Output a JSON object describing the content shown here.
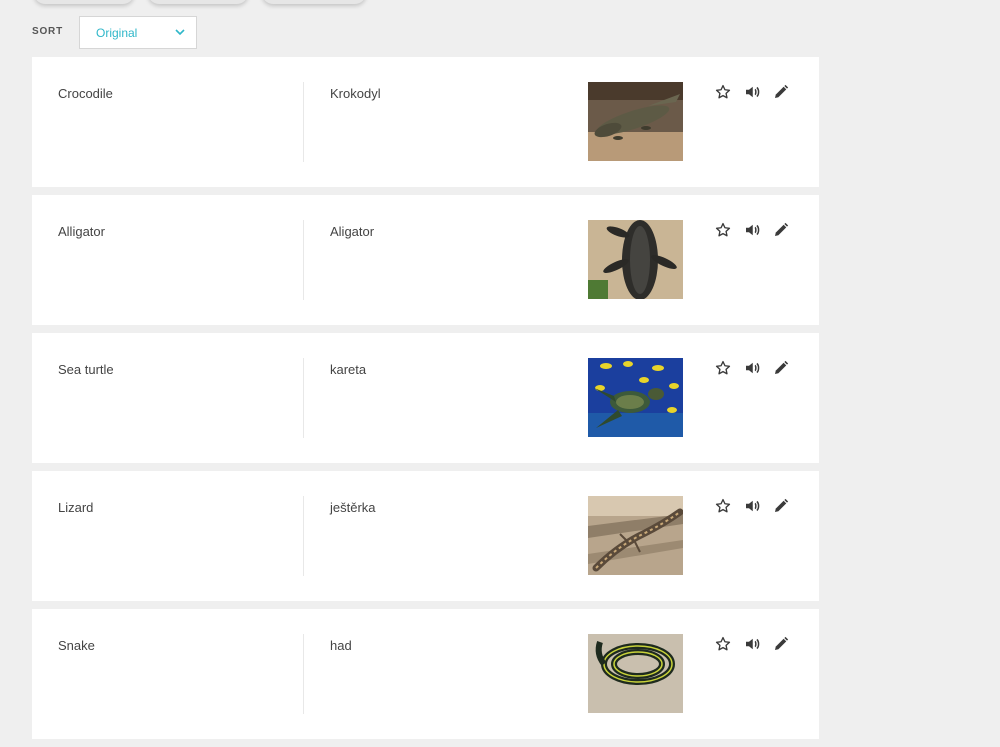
{
  "sort": {
    "label": "SORT",
    "selected": "Original"
  },
  "terms": [
    {
      "term": "Crocodile",
      "definition": "Krokodyl",
      "image": "crocodile-photo"
    },
    {
      "term": "Alligator",
      "definition": "Aligator",
      "image": "alligator-photo"
    },
    {
      "term": "Sea turtle",
      "definition": "kareta",
      "image": "sea-turtle-photo"
    },
    {
      "term": "Lizard",
      "definition": "ještěrka",
      "image": "lizard-photo"
    },
    {
      "term": "Snake",
      "definition": "had",
      "image": "snake-photo"
    }
  ],
  "icons": {
    "star": "star-icon",
    "audio": "speaker-icon",
    "edit": "pencil-icon"
  },
  "colors": {
    "accent": "#2fb7c9",
    "background": "#efefef",
    "card": "#ffffff",
    "icon": "#3a3a3a"
  }
}
